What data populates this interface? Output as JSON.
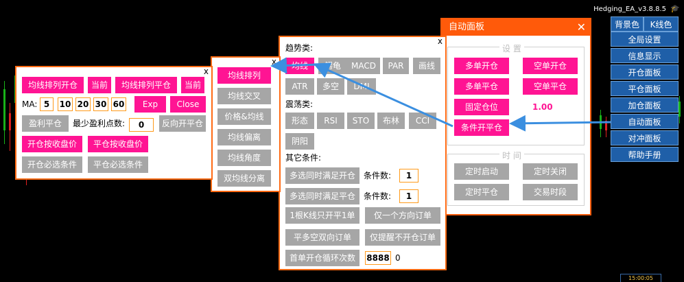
{
  "window": {
    "title": "Hedging_EA_v3.8.8.5",
    "cap_icon": "graduation-cap-icon"
  },
  "colors": {
    "accent_orange": "#ff6a13",
    "pink": "#ff1493",
    "gray": "#a6a6a6",
    "nav_blue": "#1f5fa8",
    "arrow_blue": "#3b8fe0",
    "value_pink": "#ff1493"
  },
  "right_nav": {
    "bg_color_label": "背景色",
    "kline_color_label": "K线色",
    "items": [
      "全局设置",
      "信息显示",
      "开仓面板",
      "平仓面板",
      "加仓面板",
      "自动面板",
      "对冲面板",
      "帮助手册"
    ]
  },
  "auto_panel": {
    "title": "自动面板",
    "close": "✕",
    "settings_title": "设 置",
    "multi_open": "多单开仓",
    "short_open": "空单开仓",
    "multi_close": "多单平仓",
    "short_close": "空单平仓",
    "fixed_lot": "固定仓位",
    "fixed_lot_value": "1.00",
    "condition_open_close": "条件开平仓",
    "time_title": "时 间",
    "timer_start": "定时启动",
    "timer_close": "定时关闭",
    "timer_flat": "定时平仓",
    "trade_period": "交易时段"
  },
  "condition_panel": {
    "close": "x",
    "trend_label": "趋势类:",
    "trend_buttons": [
      "均线",
      "鳄龟",
      "MACD",
      "PAR",
      "画线",
      "ATR",
      "多空",
      "DMI"
    ],
    "osc_label": "震荡类:",
    "osc_buttons": [
      "形态",
      "RSI",
      "STO",
      "布林",
      "CCI",
      "阴阳"
    ],
    "other_label": "其它条件:",
    "multi_open_satisfy": "多选同时满足开仓",
    "cond_count_label_1": "条件数:",
    "cond_count_1": "1",
    "multi_close_satisfy": "多选同时满足平仓",
    "cond_count_label_2": "条件数:",
    "cond_count_2": "1",
    "one_kline_one": "1根K线只开平1单",
    "one_direction": "仅一个方向订单",
    "flat_hedge": "平多空双向订单",
    "remind_only": "仅提醒不开仓订单",
    "first_loop": "首单开仓循环次数",
    "first_loop_value": "8888",
    "first_loop_count": "0"
  },
  "ma_type_panel": {
    "close": "x",
    "items": [
      "均线排列",
      "均线交叉",
      "价格&均线",
      "均线偏离",
      "均线角度",
      "双均线分离"
    ]
  },
  "ma_panel": {
    "close": "x",
    "ma_open": "均线排列开仓",
    "current_1": "当前",
    "ma_close": "均线排列平仓",
    "current_2": "当前",
    "ma_label": "MA:",
    "ma_values": [
      "5",
      "10",
      "20",
      "30",
      "60"
    ],
    "exp": "Exp",
    "close_btn": "Close",
    "profit_flat": "盈利平仓",
    "min_profit_label": "最少盈利点数:",
    "min_profit_value": "0",
    "reverse_open": "反向开平仓",
    "open_by_close": "开仓按收盘价",
    "flat_by_close": "平仓按收盘价",
    "open_required": "开仓必选条件",
    "flat_required": "平仓必选条件"
  },
  "bottom_box": {
    "text": "15:00:05"
  }
}
